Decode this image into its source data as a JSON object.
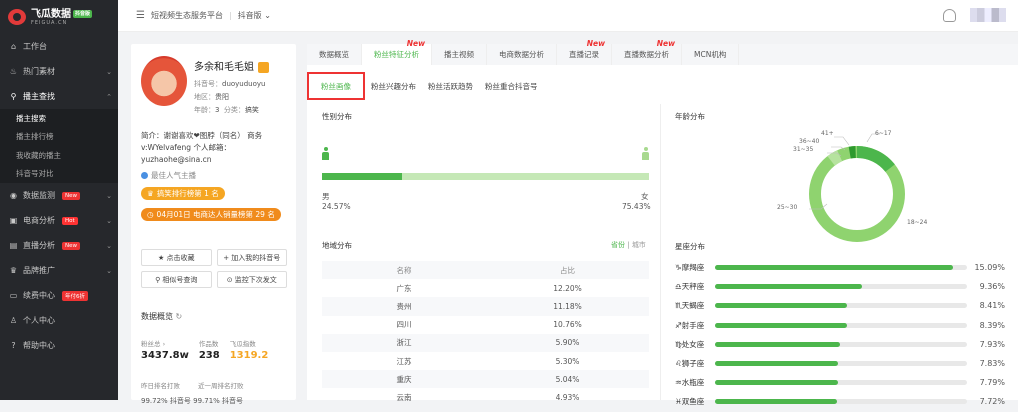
{
  "logo": {
    "title": "飞瓜数据",
    "badge": "抖音版",
    "sub": "FEIGUA.CN"
  },
  "sidebar": {
    "items": [
      {
        "icon": "⌂",
        "label": "工作台"
      },
      {
        "icon": "♨",
        "label": "热门素材",
        "chev": "⌄"
      },
      {
        "icon": "⚲",
        "label": "播主查找",
        "chev": "⌃"
      },
      {
        "icon": "◉",
        "label": "数据监测",
        "tag": "New",
        "chev": "⌄"
      },
      {
        "icon": "▣",
        "label": "电商分析",
        "tag": "Hot",
        "chev": "⌄"
      },
      {
        "icon": "▤",
        "label": "直播分析",
        "tag": "New",
        "chev": "⌄"
      },
      {
        "icon": "♛",
        "label": "品牌推广",
        "chev": "⌄"
      },
      {
        "icon": "▭",
        "label": "续费中心",
        "tag": "年付6折"
      },
      {
        "icon": "♙",
        "label": "个人中心"
      },
      {
        "icon": "?",
        "label": "帮助中心"
      }
    ],
    "sub_items": [
      "播主搜索",
      "播主排行榜",
      "我收藏的播主",
      "抖音号对比"
    ]
  },
  "topbar": {
    "menu_icon": "☰",
    "title": "短视频生态服务平台",
    "sep": "|",
    "platform": "抖音版",
    "platform_chev": "⌄"
  },
  "profile": {
    "name": "多余和毛毛姐",
    "douyin_label": "抖音号：",
    "douyin": "duoyuduoyu",
    "region_label": "地区：",
    "region": "贵阳",
    "age_label": "年龄：",
    "age": "3",
    "category_label": "分类：",
    "category": "搞笑",
    "bio": "简介：谢谢喜欢❤图脖（同名） 商务v:WYelvafeng 个人邮箱：yuzhaohe@sina.cn",
    "best": "最佳人气主播",
    "pill1": "搞笑排行榜第 1 名",
    "pill2": "04月01日 电商达人销量榜第 29 名",
    "buttons": [
      "★ 点击收藏",
      "+ 加入我的抖音号",
      "⚲ 相似号查询",
      "⊙ 监控下次发文"
    ],
    "overview_title": "数据概览",
    "stats": [
      {
        "label": "粉丝总 ›",
        "value": "3437.8w"
      },
      {
        "label": "作品数",
        "value": "238"
      },
      {
        "label": "飞瓜指数",
        "value": "1319.2"
      }
    ],
    "rank_labels": [
      "昨日排名打败",
      "近一周排名打败"
    ],
    "rank_values": "99.72% 抖音号   99.71% 抖音号"
  },
  "tabs": [
    {
      "label": "数据概览"
    },
    {
      "label": "粉丝特征分析",
      "flag": "New"
    },
    {
      "label": "播主视频"
    },
    {
      "label": "电商数据分析"
    },
    {
      "label": "直播记录",
      "flag": "New"
    },
    {
      "label": "直播数据分析",
      "flag": "New"
    },
    {
      "label": "MCN机构"
    }
  ],
  "subtabs": [
    "粉丝画像",
    "粉丝兴趣分布",
    "粉丝活跃趋势",
    "粉丝重合抖音号"
  ],
  "gender": {
    "title": "性别分布",
    "male_label": "男",
    "male_pct": "24.57%",
    "male_value": 24.57,
    "female_label": "女",
    "female_pct": "75.43%"
  },
  "region": {
    "title": "地域分布",
    "toggle_on": "省份",
    "toggle_sep": " | ",
    "toggle_off": "城市",
    "headers": [
      "名称",
      "占比"
    ],
    "rows": [
      [
        "广东",
        "12.20%"
      ],
      [
        "贵州",
        "11.18%"
      ],
      [
        "四川",
        "10.76%"
      ],
      [
        "浙江",
        "5.90%"
      ],
      [
        "江苏",
        "5.30%"
      ],
      [
        "重庆",
        "5.04%"
      ],
      [
        "云南",
        "4.93%"
      ]
    ]
  },
  "age_chart": {
    "title": "年龄分布",
    "labels": [
      "41+",
      "36~40",
      "31~35",
      "6~17",
      "25~30",
      "18~24"
    ]
  },
  "zodiac": {
    "title": "星座分布",
    "rows": [
      {
        "icon": "♑",
        "name": "摩羯座",
        "pct": "15.09%",
        "value": 15.09
      },
      {
        "icon": "♎",
        "name": "天秤座",
        "pct": "9.36%",
        "value": 9.36
      },
      {
        "icon": "♏",
        "name": "天蝎座",
        "pct": "8.41%",
        "value": 8.41
      },
      {
        "icon": "♐",
        "name": "射手座",
        "pct": "8.39%",
        "value": 8.39
      },
      {
        "icon": "♍",
        "name": "处女座",
        "pct": "7.93%",
        "value": 7.93
      },
      {
        "icon": "♌",
        "name": "狮子座",
        "pct": "7.83%",
        "value": 7.83
      },
      {
        "icon": "♒",
        "name": "水瓶座",
        "pct": "7.79%",
        "value": 7.79
      },
      {
        "icon": "♓",
        "name": "双鱼座",
        "pct": "7.72%",
        "value": 7.72
      }
    ]
  },
  "colors": {
    "accent": "#4cb64c",
    "light": "#a8d98f",
    "warn": "#f5a623",
    "danger": "#e33333"
  }
}
